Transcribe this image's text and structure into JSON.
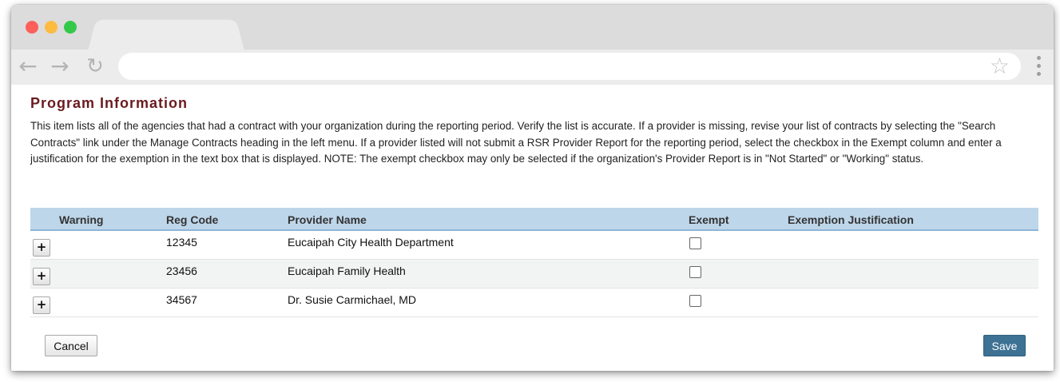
{
  "browser": {
    "icons": {
      "back": "arrow-left-icon",
      "forward": "arrow-right-icon",
      "reload": "reload-icon",
      "bookmark": "star-icon",
      "menu": "kebab-menu-icon"
    },
    "url": ""
  },
  "page": {
    "title": "Program Information",
    "description": "This item lists all of the agencies that had a contract with your organization during the reporting period. Verify the list is accurate. If a provider is missing, revise your list of contracts by selecting the \"Search Contracts\" link under the Manage Contracts heading in the left menu. If a provider listed will not submit a RSR Provider Report for the reporting period, select the checkbox in the Exempt column and enter a justification for the exemption in the text box that is displayed. NOTE: The exempt checkbox may only be selected if the organization's Provider Report is in \"Not Started\" or \"Working\" status."
  },
  "table": {
    "columns": {
      "warning": "Warning",
      "reg_code": "Reg Code",
      "provider_name": "Provider Name",
      "exempt": "Exempt",
      "justification": "Exemption Justification"
    },
    "rows": [
      {
        "expand": "+",
        "warning": "",
        "reg_code": "12345",
        "provider_name": "Eucaipah City Health Department",
        "exempt": false,
        "justification": ""
      },
      {
        "expand": "+",
        "warning": "",
        "reg_code": "23456",
        "provider_name": "Eucaipah Family Health",
        "exempt": false,
        "justification": ""
      },
      {
        "expand": "+",
        "warning": "",
        "reg_code": "34567",
        "provider_name": "Dr. Susie Carmichael, MD",
        "exempt": false,
        "justification": ""
      }
    ]
  },
  "actions": {
    "cancel_label": "Cancel",
    "save_label": "Save"
  },
  "colors": {
    "title": "#6a1a1f",
    "header_bg": "#bed6ea",
    "save_bg": "#3e7295"
  }
}
